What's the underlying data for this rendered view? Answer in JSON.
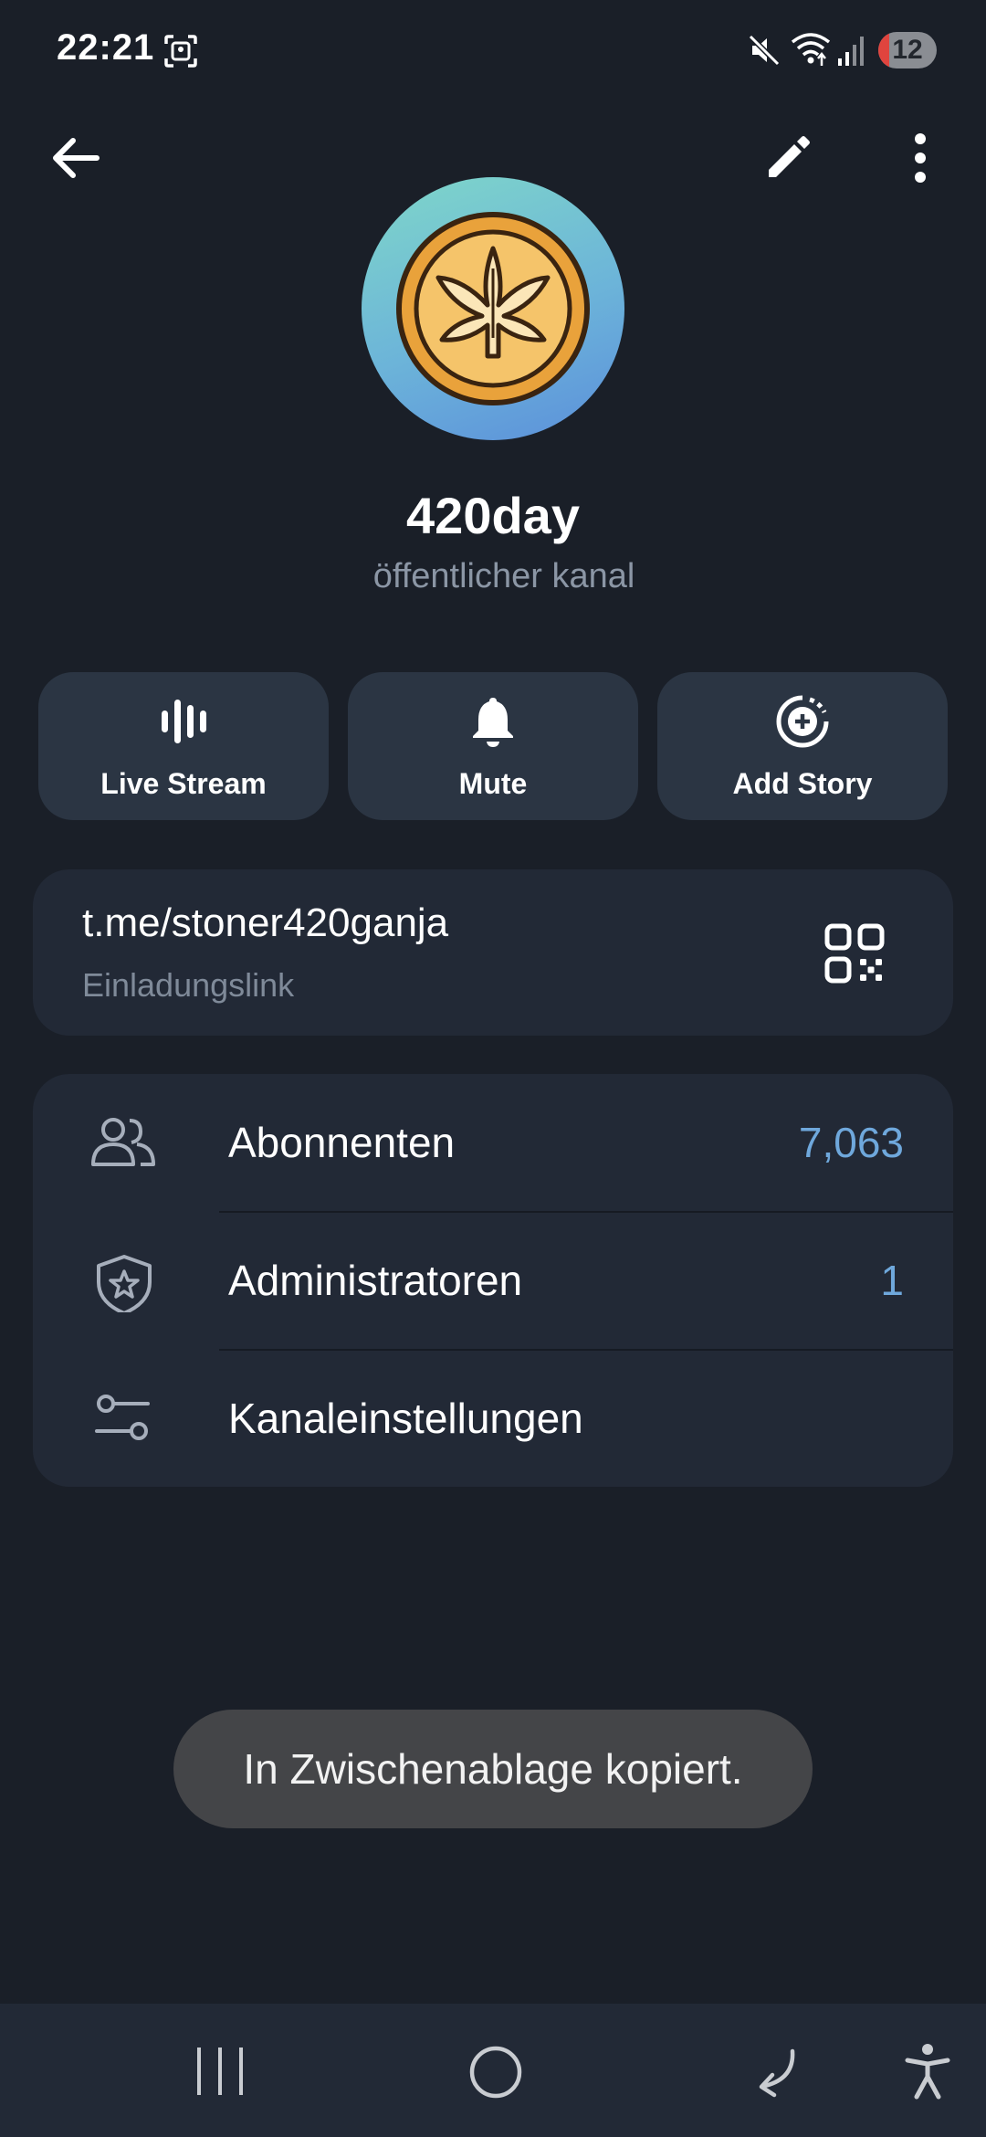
{
  "status_bar": {
    "time": "22:21",
    "battery_level": "12",
    "icons": [
      "screenshot-icon",
      "mute-icon",
      "wifi-icon",
      "signal-icon"
    ]
  },
  "top_bar": {
    "icons": [
      "back-arrow-icon",
      "pencil-icon",
      "more-vertical-icon"
    ]
  },
  "channel": {
    "name": "420day",
    "type": "öffentlicher kanal",
    "avatar_icon": "cannabis-leaf-coin"
  },
  "actions": [
    {
      "label": "Live Stream",
      "icon": "live-stream-icon"
    },
    {
      "label": "Mute",
      "icon": "bell-icon"
    },
    {
      "label": "Add Story",
      "icon": "add-story-icon"
    }
  ],
  "link": {
    "url": "t.me/stoner420ganja",
    "label": "Einladungslink",
    "icon": "qr-code-icon"
  },
  "menu": [
    {
      "title": "Abonnenten",
      "value": "7,063",
      "icon": "people-icon"
    },
    {
      "title": "Administratoren",
      "value": "1",
      "icon": "shield-star-icon"
    },
    {
      "title": "Kanaleinstellungen",
      "value": "",
      "icon": "sliders-icon"
    }
  ],
  "toast": {
    "message": "In Zwischenablage kopiert."
  },
  "nav_bar": {
    "icons": [
      "recents-icon",
      "home-icon",
      "back-icon",
      "accessibility-icon"
    ]
  },
  "colors": {
    "background": "#1a1f28",
    "card": "#222936",
    "action_button": "#2b3543",
    "accent_value": "#6fa8dc",
    "secondary_text": "#8b96a5",
    "toast": "#444548"
  }
}
